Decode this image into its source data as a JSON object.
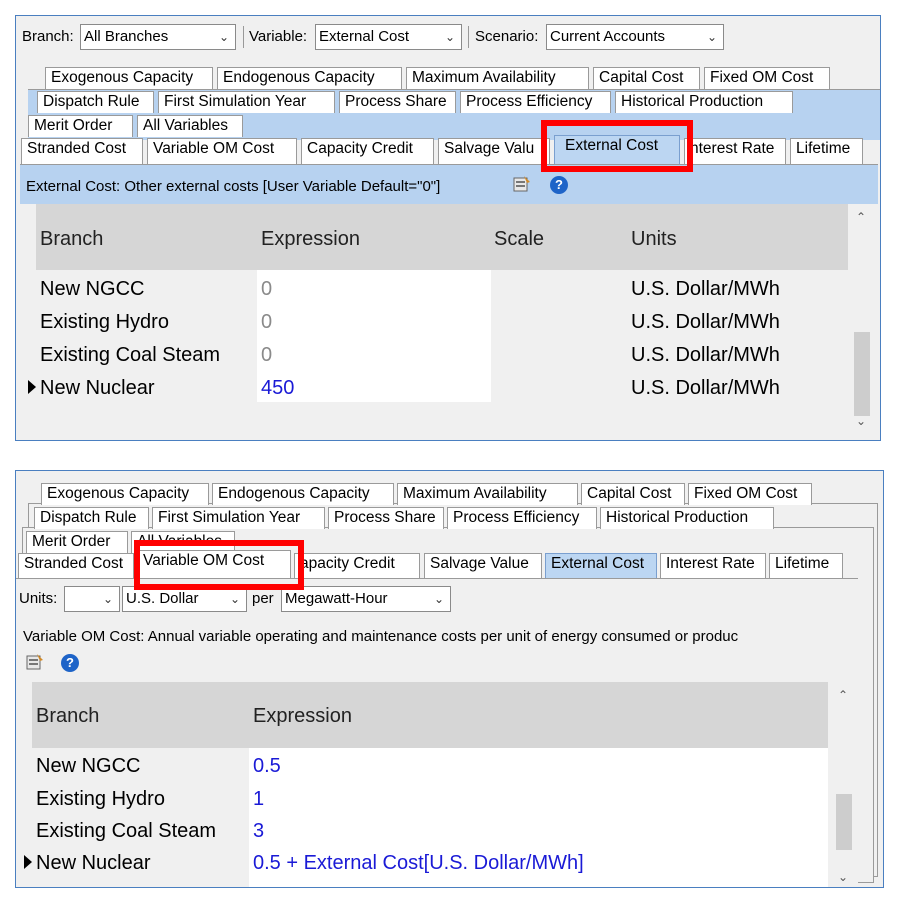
{
  "top": {
    "filters": {
      "branch_label": "Branch:",
      "branch_value": "All Branches",
      "variable_label": "Variable:",
      "variable_value": "External Cost",
      "scenario_label": "Scenario:",
      "scenario_value": "Current Accounts"
    },
    "tabs_row1": [
      "Exogenous Capacity",
      "Endogenous Capacity",
      "Maximum Availability",
      "Capital Cost",
      "Fixed OM Cost"
    ],
    "tabs_row2": [
      "Dispatch Rule",
      "First Simulation Year",
      "Process Share",
      "Process Efficiency",
      "Historical Production"
    ],
    "tabs_row3": [
      "Merit Order",
      "All Variables"
    ],
    "tabs_row4": [
      "Stranded Cost",
      "Variable OM Cost",
      "Capacity Credit",
      "Salvage Valu",
      "External Cost",
      "nterest Rate",
      "Lifetime"
    ],
    "description": "External Cost: Other external costs [User Variable Default=\"0\"]",
    "columns": [
      "Branch",
      "Expression",
      "Scale",
      "Units"
    ],
    "rows": [
      {
        "branch": "New NGCC",
        "expression": "0",
        "scale": "",
        "units": "U.S. Dollar/MWh"
      },
      {
        "branch": "Existing Hydro",
        "expression": "0",
        "scale": "",
        "units": "U.S. Dollar/MWh"
      },
      {
        "branch": "Existing Coal Steam",
        "expression": "0",
        "scale": "",
        "units": "U.S. Dollar/MWh"
      },
      {
        "branch": "New Nuclear",
        "expression": "450",
        "scale": "",
        "units": "U.S. Dollar/MWh"
      }
    ],
    "colors": {
      "default_value": "#8a8a8a",
      "user_value": "#1a1ad6",
      "highlight": "#ff0000"
    }
  },
  "bottom": {
    "tabs_row1": [
      "Exogenous Capacity",
      "Endogenous Capacity",
      "Maximum Availability",
      "Capital Cost",
      "Fixed OM Cost"
    ],
    "tabs_row2": [
      "Dispatch Rule",
      "First Simulation Year",
      "Process Share",
      "Process Efficiency",
      "Historical Production"
    ],
    "tabs_row3": [
      "Merit Order",
      "All Variables"
    ],
    "tabs_row4": [
      "Stranded Cost",
      "Variable OM Cost",
      "apacity Credit",
      "Salvage Value",
      "External Cost",
      "Interest Rate",
      "Lifetime"
    ],
    "units": {
      "label": "Units:",
      "unit_value": "",
      "currency_value": "U.S. Dollar",
      "per_label": "per",
      "per_value": "Megawatt-Hour"
    },
    "description": "Variable OM Cost: Annual variable operating and maintenance costs per unit of energy consumed or produc",
    "columns": [
      "Branch",
      "Expression"
    ],
    "rows": [
      {
        "branch": "New NGCC",
        "expression": "0.5"
      },
      {
        "branch": "Existing Hydro",
        "expression": "1"
      },
      {
        "branch": "Existing Coal Steam",
        "expression": "3"
      },
      {
        "branch": "New Nuclear",
        "expression": "0.5 + External Cost[U.S. Dollar/MWh]"
      }
    ]
  }
}
